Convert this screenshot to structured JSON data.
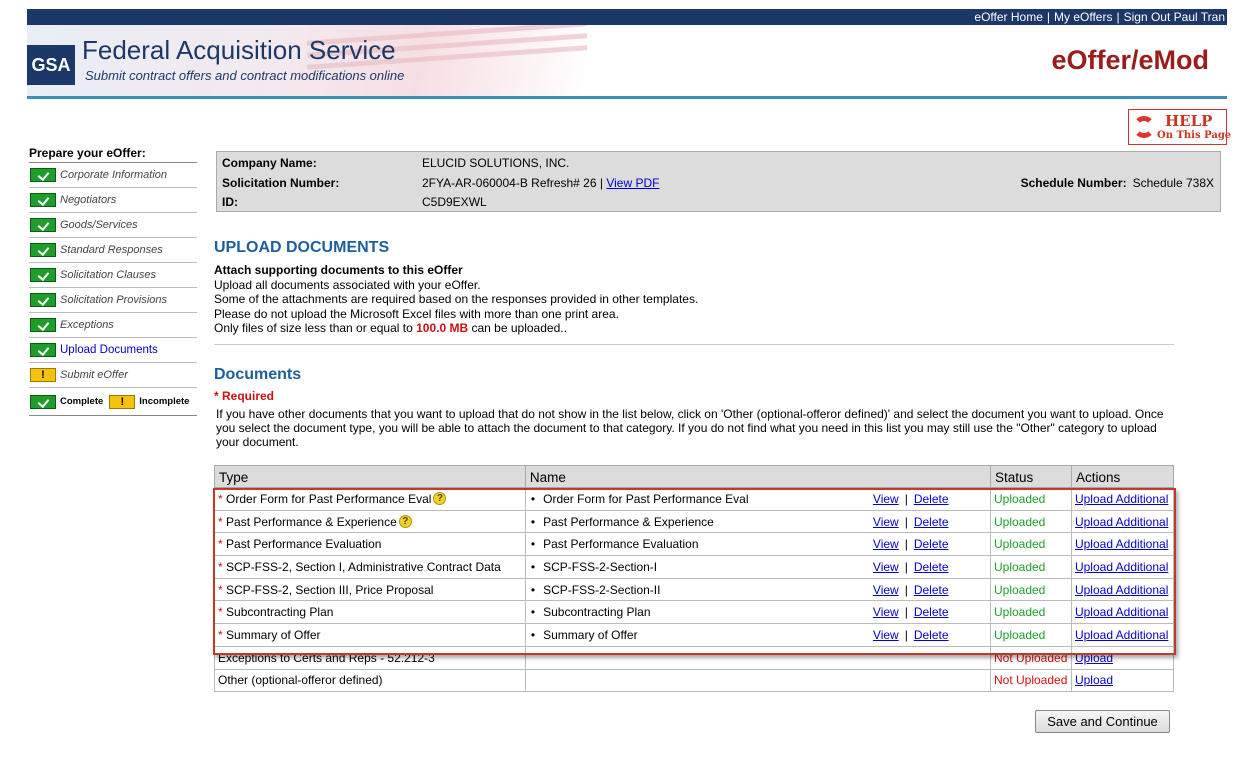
{
  "topnav": {
    "home": "eOffer Home",
    "my_eoffers": "My eOffers",
    "sign_out": "Sign Out Paul Tran",
    "sep": "|"
  },
  "header": {
    "logo": "GSA",
    "title": "Federal Acquisition Service",
    "subtitle": "Submit contract offers and contract modifications online",
    "app_title": "eOffer/eMod"
  },
  "help": {
    "line1": "HELP",
    "line2": "On This Page"
  },
  "sidebar": {
    "title": "Prepare your eOffer:",
    "items": [
      {
        "label": "Corporate Information",
        "status": "complete"
      },
      {
        "label": "Negotiators",
        "status": "complete"
      },
      {
        "label": "Goods/Services",
        "status": "complete"
      },
      {
        "label": "Standard Responses",
        "status": "complete"
      },
      {
        "label": "Solicitation Clauses",
        "status": "complete"
      },
      {
        "label": "Solicitation Provisions",
        "status": "complete"
      },
      {
        "label": "Exceptions",
        "status": "complete"
      },
      {
        "label": "Upload Documents",
        "status": "complete",
        "active": true
      },
      {
        "label": "Submit eOffer",
        "status": "incomplete"
      }
    ],
    "legend": {
      "complete": "Complete",
      "incomplete": "Incomplete",
      "warn_glyph": "!"
    }
  },
  "info": {
    "company_label": "Company Name:",
    "company_value": "ELUCID SOLUTIONS, INC.",
    "solicitation_label": "Solicitation Number:",
    "solicitation_value": "2FYA-AR-060004-B Refresh# 26 |",
    "view_pdf": "View PDF",
    "id_label": "ID:",
    "id_value": "C5D9EXWL",
    "schedule_label": "Schedule Number:",
    "schedule_value": "Schedule 738X"
  },
  "upload": {
    "heading": "UPLOAD DOCUMENTS",
    "subheading": "Attach supporting documents to this eOffer",
    "line1": "Upload all documents associated with your eOffer.",
    "line2": "Some of the attachments are required based on the responses provided in other templates.",
    "line3": "Please do not upload the Microsoft Excel files with more than one print area.",
    "line4_pre": "Only files of size less than or equal to",
    "line4_size": "100.0 MB",
    "line4_post": "can be uploaded.."
  },
  "documents": {
    "heading": "Documents",
    "required": "* Required",
    "note": "If you have other documents that you want to upload that do not show in the list below, click on 'Other (optional-offeror defined)' and select the document you want to upload. Once you select the document type, you will be able to attach the document to that category. If you do not find what you need in this list you may still use the \"Other\" category to upload your document.",
    "columns": {
      "type": "Type",
      "name": "Name",
      "status": "Status",
      "actions": "Actions"
    },
    "rows": [
      {
        "required": true,
        "type": "Order Form for Past Performance Eval",
        "help": true,
        "name": "Order Form for Past Performance Eval",
        "view": "View",
        "delete": "Delete",
        "status": "Uploaded",
        "action": "Upload Additional"
      },
      {
        "required": true,
        "type": "Past Performance & Experience",
        "help": true,
        "name": "Past Performance & Experience",
        "view": "View",
        "delete": "Delete",
        "status": "Uploaded",
        "action": "Upload Additional"
      },
      {
        "required": true,
        "type": "Past Performance Evaluation",
        "name": "Past Performance Evaluation",
        "view": "View",
        "delete": "Delete",
        "status": "Uploaded",
        "action": "Upload Additional"
      },
      {
        "required": true,
        "type": "SCP-FSS-2, Section I, Administrative Contract Data",
        "name": "SCP-FSS-2-Section-I",
        "view": "View",
        "delete": "Delete",
        "status": "Uploaded",
        "action": "Upload Additional"
      },
      {
        "required": true,
        "type": "SCP-FSS-2, Section III, Price Proposal",
        "name": "SCP-FSS-2-Section-II",
        "view": "View",
        "delete": "Delete",
        "status": "Uploaded",
        "action": "Upload Additional"
      },
      {
        "required": true,
        "type": "Subcontracting Plan",
        "name": "Subcontracting Plan",
        "view": "View",
        "delete": "Delete",
        "status": "Uploaded",
        "action": "Upload Additional"
      },
      {
        "required": true,
        "type": "Summary of Offer",
        "name": "Summary of Offer",
        "view": "View",
        "delete": "Delete",
        "status": "Uploaded",
        "action": "Upload Additional"
      },
      {
        "required": false,
        "type": "Exceptions to Certs and Reps - 52.212-3",
        "name": "",
        "status": "Not Uploaded",
        "action": "Upload"
      },
      {
        "required": false,
        "type": "Other (optional-offeror defined)",
        "name": "",
        "status": "Not Uploaded",
        "action": "Upload"
      }
    ],
    "required_mark": "*",
    "bullet": "•",
    "pipe": "|",
    "help_glyph": "?",
    "colors": {
      "uploaded": "#1f9d2b",
      "not_uploaded": "#d01010"
    }
  },
  "save_button": "Save and Continue"
}
